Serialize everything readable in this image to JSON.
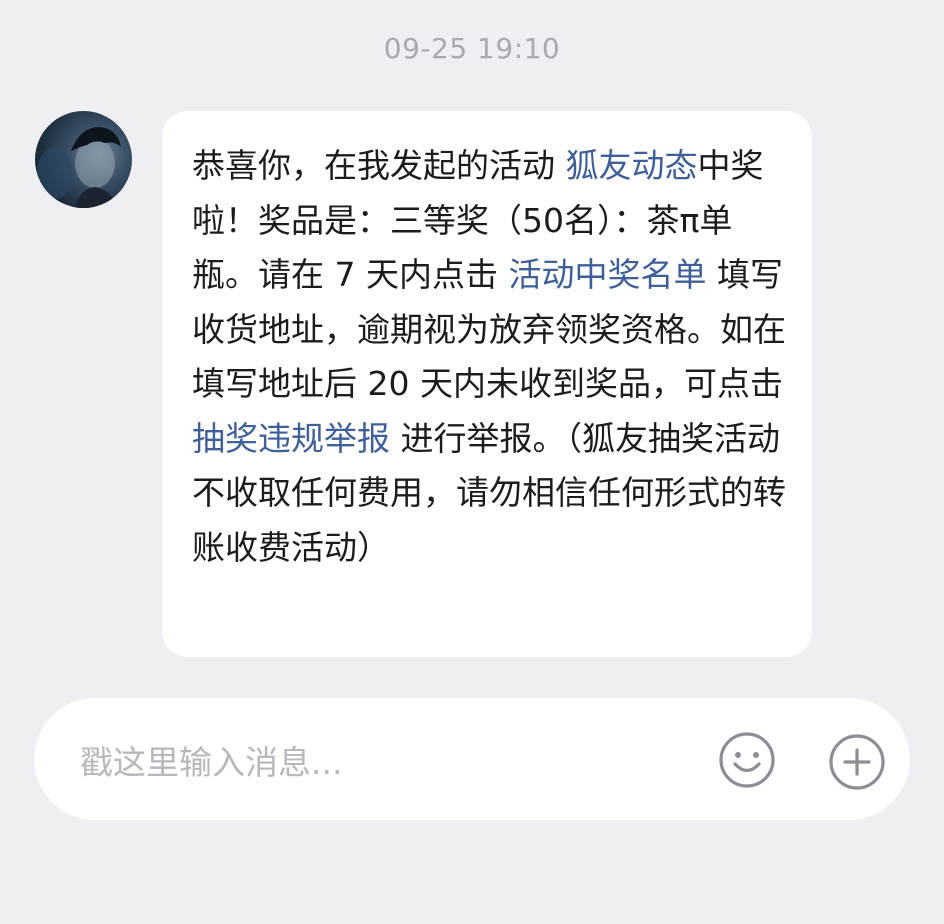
{
  "chat": {
    "timestamp": "09-25 19:10"
  },
  "message": {
    "segments": [
      {
        "text": "恭喜你，在我发起的活动 ",
        "link": false
      },
      {
        "text": "狐友动态",
        "link": true
      },
      {
        "text": "中奖啦！奖品是：三等奖（50名）：茶π单瓶。请在 7 天内点击 ",
        "link": false
      },
      {
        "text": "活动中奖名单",
        "link": true
      },
      {
        "text": " 填写收货地址，逾期视为放弃领奖资格。如在填写地址后 20 天内未收到奖品，可点击 ",
        "link": false
      },
      {
        "text": "抽奖违规举报",
        "link": true
      },
      {
        "text": " 进行举报。（狐友抽奖活动不收取任何费用，请勿相信任何形式的转账收费活动）",
        "link": false
      }
    ]
  },
  "composer": {
    "placeholder": "戳这里输入消息...",
    "emoji_icon": "smiley-face-icon",
    "add_icon": "plus-circle-icon"
  },
  "colors": {
    "background": "#eeeef3",
    "link": "#3f5f98",
    "text": "#1c1c1e",
    "muted": "#a9a9b0"
  }
}
